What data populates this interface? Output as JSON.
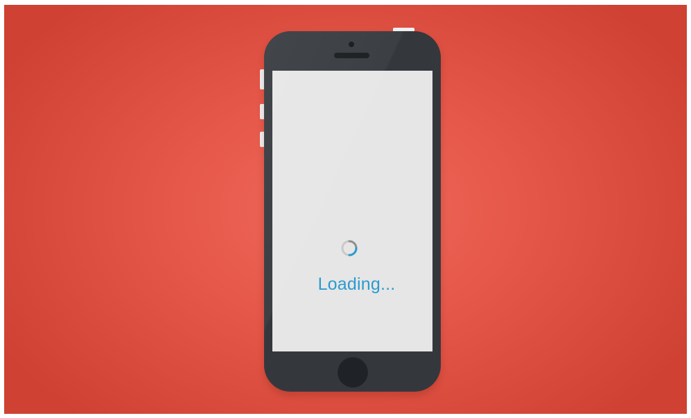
{
  "background": {
    "colors": {
      "center": "#ef6a5b",
      "edge": "#cf4233"
    }
  },
  "phone": {
    "body_color": "#34383d",
    "screen_color": "#e6e6e6",
    "accent_color": "#2b9bcf",
    "status_text": "Loading...",
    "spinner_icon": "loading-spinner-icon"
  }
}
